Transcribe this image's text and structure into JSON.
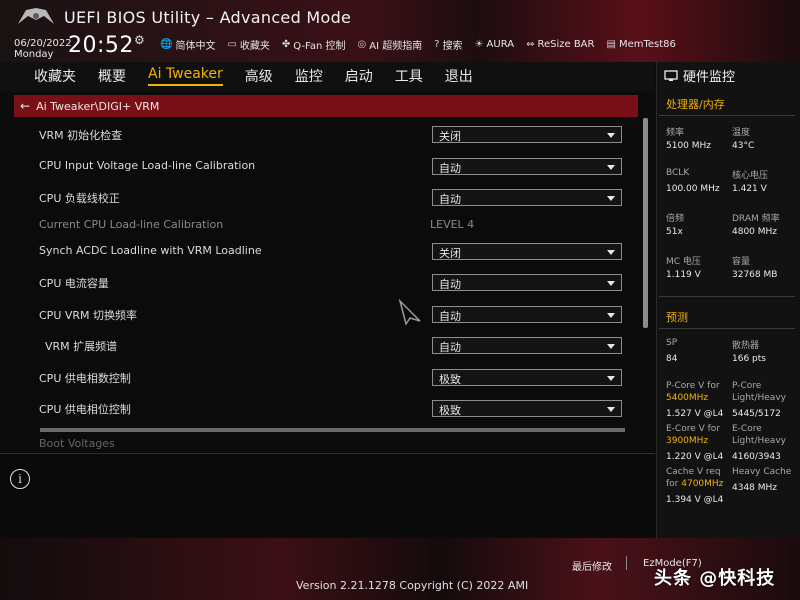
{
  "header": {
    "title": "UEFI BIOS Utility – Advanced Mode",
    "date": "06/20/2022",
    "day": "Monday",
    "time": "20:52",
    "items": [
      {
        "icon": "globe-icon",
        "label": "简体中文"
      },
      {
        "icon": "favorites-icon",
        "label": "收藏夹"
      },
      {
        "icon": "fan-icon",
        "label": "Q-Fan 控制"
      },
      {
        "icon": "ai-icon",
        "label": "AI 超频指南"
      },
      {
        "icon": "help-icon",
        "label": "搜索"
      },
      {
        "icon": "aura-icon",
        "label": "AURA"
      },
      {
        "icon": "resize-bar-icon",
        "label": "ReSize BAR"
      },
      {
        "icon": "memtest-icon",
        "label": "MemTest86"
      }
    ]
  },
  "nav": {
    "tabs": [
      "收藏夹",
      "概要",
      "Ai Tweaker",
      "高级",
      "监控",
      "启动",
      "工具",
      "退出"
    ],
    "active": "Ai Tweaker"
  },
  "breadcrumb": "Ai Tweaker\\DIGI+ VRM",
  "settings": [
    {
      "label": "VRM 初始化检查",
      "value": "关闭",
      "type": "select"
    },
    {
      "label": "CPU Input Voltage Load-line Calibration",
      "value": "自动",
      "type": "select"
    },
    {
      "label": "CPU 负载线校正",
      "value": "自动",
      "type": "select"
    },
    {
      "label": "Current CPU Load-line Calibration",
      "value": "LEVEL 4",
      "type": "readonly"
    },
    {
      "label": "Synch ACDC Loadline with VRM Loadline",
      "value": "关闭",
      "type": "select"
    },
    {
      "label": "CPU 电流容量",
      "value": "自动",
      "type": "select"
    },
    {
      "label": "CPU VRM 切换频率",
      "value": "自动",
      "type": "select"
    },
    {
      "label": "VRM 扩展频谱",
      "value": "自动",
      "type": "select"
    },
    {
      "label": "CPU 供电相数控制",
      "value": "极致",
      "type": "select"
    },
    {
      "label": "CPU 供电相位控制",
      "value": "极致",
      "type": "select"
    }
  ],
  "section_below": "Boot Voltages",
  "info_icon": "i",
  "hw_monitor": {
    "title": "硬件监控",
    "cpu_section": "处理器/内存",
    "cpu": [
      {
        "label": "频率",
        "value": "5100 MHz"
      },
      {
        "label": "温度",
        "value": "43°C"
      },
      {
        "label": "BCLK",
        "value": "100.00 MHz"
      },
      {
        "label": "核心电压",
        "value": "1.421 V"
      },
      {
        "label": "倍频",
        "value": "51x"
      },
      {
        "label": "DRAM 频率",
        "value": "4800 MHz"
      },
      {
        "label": "MC 电压",
        "value": "1.119 V"
      },
      {
        "label": "容量",
        "value": "32768 MB"
      }
    ],
    "predict_section": "预测",
    "sp_label": "SP",
    "sp_value": "84",
    "cooler_label": "散热器",
    "cooler_value": "166 pts",
    "pcore_label_1": "P-Core V for",
    "pcore_freq": "5400MHz",
    "pcore_v": "1.527 V @L4",
    "pcore_lh_label_1": "P-Core",
    "pcore_lh_label_2": "Light/Heavy",
    "pcore_lh_value": "5445/5172",
    "ecore_label_1": "E-Core V for",
    "ecore_freq": "3900MHz",
    "ecore_v": "1.220 V @L4",
    "ecore_lh_label_1": "E-Core",
    "ecore_lh_label_2": "Light/Heavy",
    "ecore_lh_value": "4160/3943",
    "cache_label_1": "Cache V req",
    "cache_label_2": "for",
    "cache_freq": "4700MHz",
    "cache_v": "1.394 V @L4",
    "heavy_cache_label": "Heavy Cache",
    "heavy_cache_value": "4348 MHz"
  },
  "footer": {
    "last_modified": "最后修改",
    "ez_mode": "EzMode(F7)",
    "version": "Version 2.21.1278 Copyright (C) 2022 AMI",
    "watermark": "头条 @快科技"
  }
}
